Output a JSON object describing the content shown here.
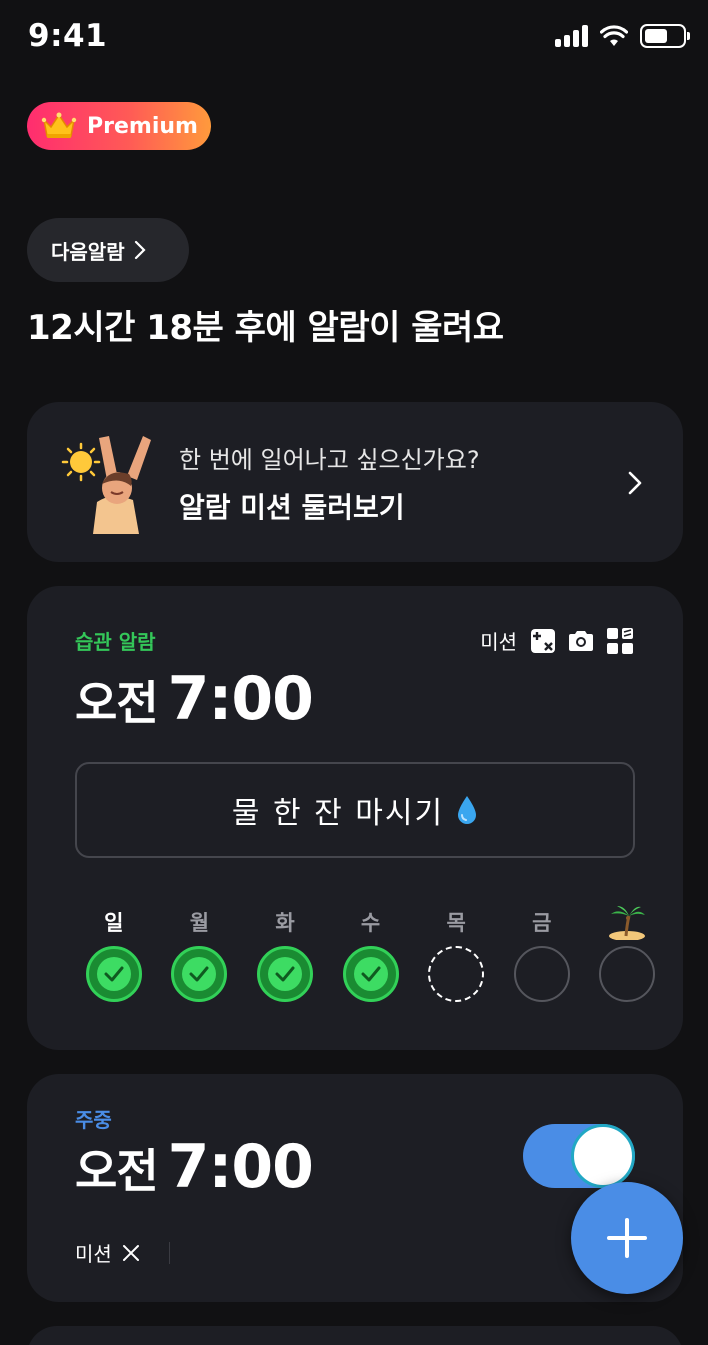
{
  "status_bar": {
    "time": "9:41"
  },
  "premium": {
    "label": "Premium",
    "icon": "crown-icon"
  },
  "next_alarm": {
    "pill_label": "다음알람",
    "headline": "12시간 18분 후에 알람이 울려요"
  },
  "mission_banner": {
    "subtitle": "한 번에 일어나고 싶으신가요?",
    "title": "알람 미션 둘러보기"
  },
  "habit_alarm": {
    "tag": "습관 알람",
    "mission_label": "미션",
    "mission_icons": [
      "math-icon",
      "camera-icon",
      "qr-icon"
    ],
    "ampm": "오전",
    "time": "7:00",
    "memo": "물 한 잔 마시기",
    "memo_icon": "droplet-icon",
    "days": [
      {
        "label": "일",
        "state": "done",
        "today": true
      },
      {
        "label": "월",
        "state": "done"
      },
      {
        "label": "화",
        "state": "done"
      },
      {
        "label": "수",
        "state": "done"
      },
      {
        "label": "목",
        "state": "pending"
      },
      {
        "label": "금",
        "state": "empty"
      },
      {
        "label": "",
        "icon": "island-icon",
        "state": "empty"
      }
    ],
    "colors": {
      "tag": "#34c759",
      "done": "#3ddc63"
    }
  },
  "weekday_alarm": {
    "tag": "주중",
    "ampm": "오전",
    "time": "7:00",
    "enabled": true,
    "mission_label": "미션",
    "mission_icon": "close-icon",
    "colors": {
      "tag": "#4a8de6",
      "toggle": "#4a8de6"
    }
  },
  "fab": {
    "icon": "plus-icon"
  }
}
